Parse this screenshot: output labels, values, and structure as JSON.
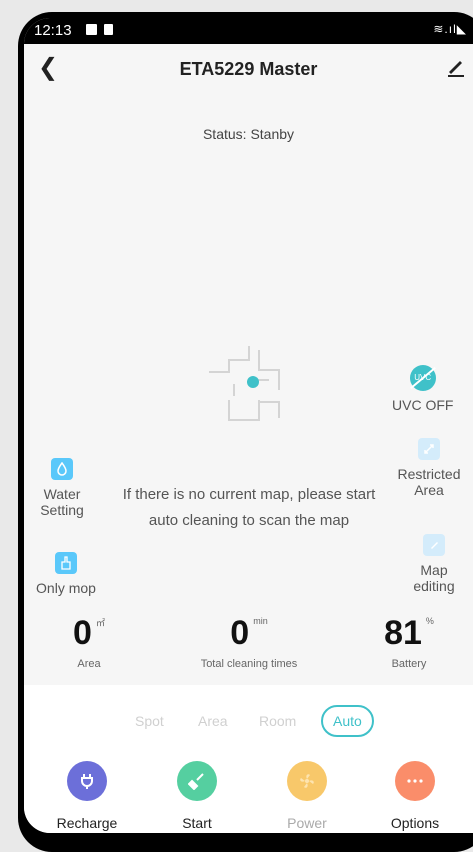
{
  "statusbar": {
    "time": "12:13"
  },
  "appbar": {
    "title": "ETA5229 Master"
  },
  "status": "Status: Stanby",
  "right_controls": {
    "uvc": {
      "icon_text": "UVC",
      "label": "UVC OFF"
    },
    "restricted_area": {
      "label_line1": "Restricted",
      "label_line2": "Area"
    },
    "map_editing": {
      "label_line1": "Map",
      "label_line2": "editing"
    }
  },
  "left_controls": {
    "water_setting": {
      "label_line1": "Water",
      "label_line2": "Setting"
    },
    "only_mop": {
      "label": "Only mop"
    }
  },
  "map_message": "If there is no current map, please start auto cleaning to scan the map",
  "stats": [
    {
      "value": "0",
      "unit": "㎡",
      "label": "Area"
    },
    {
      "value": "0",
      "unit": "min",
      "label": "Total cleaning times"
    },
    {
      "value": "81",
      "unit": "%",
      "label": "Battery"
    }
  ],
  "modes": [
    "Spot",
    "Area",
    "Room",
    "Auto"
  ],
  "selected_mode": "Auto",
  "actions": [
    {
      "label": "Recharge",
      "icon": "plug-icon",
      "color": "#6c6fd9"
    },
    {
      "label": "Start",
      "icon": "broom-icon",
      "color": "#55cfa0"
    },
    {
      "label": "Power",
      "icon": "fan-icon",
      "color": "#f8c86a"
    },
    {
      "label": "Options",
      "icon": "more-icon",
      "color": "#fa8d6a"
    }
  ]
}
